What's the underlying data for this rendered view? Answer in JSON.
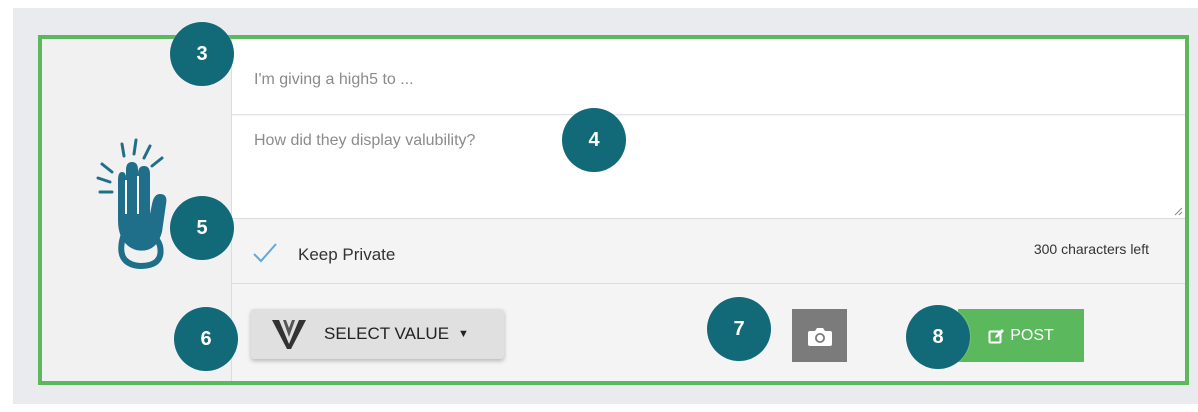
{
  "composer": {
    "recipient_placeholder": "I'm giving a high5 to ...",
    "message_placeholder": "How did they display valubility?",
    "keep_private_label": "Keep Private",
    "keep_private_checked": true,
    "chars_left_text": "300 characters left",
    "select_value_label": "SELECT VALUE",
    "post_label": "POST"
  },
  "callouts": [
    "3",
    "4",
    "5",
    "6",
    "7",
    "8"
  ],
  "icons": {
    "logo": "high5-hand-icon",
    "check": "check-icon",
    "value": "v-logo-icon",
    "caret": "caret-down-icon",
    "camera": "camera-icon",
    "post": "edit-icon"
  },
  "colors": {
    "accent_green": "#5cb85c",
    "callout_teal": "#126977",
    "logo_teal": "#1f6f8b",
    "check_blue": "#5aa9e6",
    "camera_gray": "#7b7b7b"
  }
}
